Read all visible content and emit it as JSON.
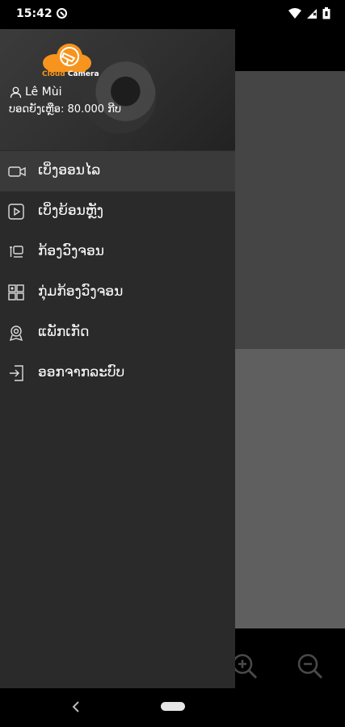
{
  "status_bar": {
    "time": "15:42"
  },
  "drawer": {
    "logo": {
      "brand_part1": "Cloud",
      "brand_part2": "Camera"
    },
    "user": {
      "name": "Lê Mùi"
    },
    "balance": "ບອດຍັງເຫຼືອ: 80.000  ກີບ",
    "menu": [
      {
        "label": "ເບິ່ງອອນໄລ",
        "icon": "video-camera-icon",
        "active": true
      },
      {
        "label": "ເບິ່ງຍ້ອນຫຼັງ",
        "icon": "playback-icon",
        "active": false
      },
      {
        "label": "ກ້ອງວົງຈອນ",
        "icon": "camera-icon",
        "active": false
      },
      {
        "label": "ກຸ່ມກ້ອງວົງຈອນ",
        "icon": "camera-group-icon",
        "active": false
      },
      {
        "label": "ແພັກເກັດ",
        "icon": "package-badge-icon",
        "active": false
      },
      {
        "label": "ອອກຈາກລະບົບ",
        "icon": "logout-icon",
        "active": false
      }
    ]
  },
  "colors": {
    "accent": "#f7941d",
    "drawer_bg": "#2a2a2a",
    "active_item_bg": "#3a3a3a"
  }
}
